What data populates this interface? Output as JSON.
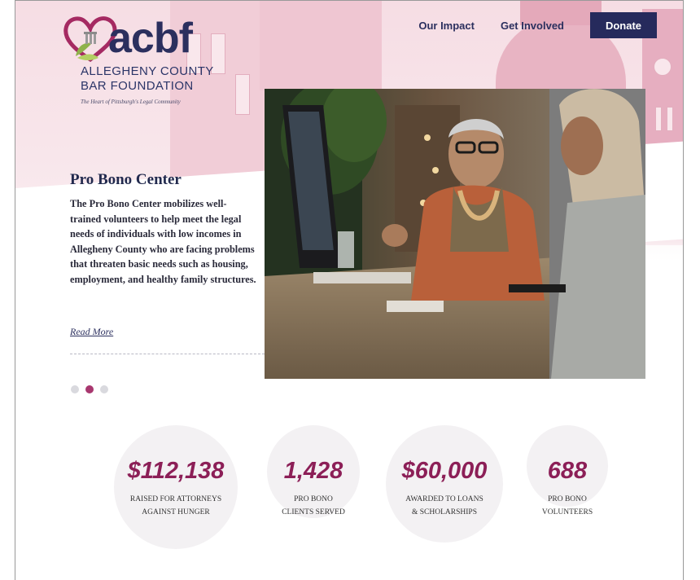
{
  "header": {
    "logo": {
      "wordmark": "acbf",
      "line1": "ALLEGHENY COUNTY",
      "line2": "BAR FOUNDATION",
      "tagline": "The Heart of Pittsburgh's Legal Community"
    },
    "nav": [
      "Our Impact",
      "Get Involved"
    ],
    "donate_label": "Donate"
  },
  "slide": {
    "title": "Pro Bono Center",
    "body": "The Pro Bono Center mobilizes well-trained volunteers to help meet the legal needs of individuals with low incomes in Allegheny County who are facing problems that threaten basic needs such as housing, employment, and healthy family structures.",
    "link_label": "Read More",
    "dots": {
      "count": 3,
      "active": 1
    }
  },
  "stats": [
    {
      "value": "$112,138",
      "label_line1": "RAISED FOR ATTORNEYS",
      "label_line2": "AGAINST HUNGER"
    },
    {
      "value": "1,428",
      "label_line1": "PRO BONO",
      "label_line2": "CLIENTS SERVED"
    },
    {
      "value": "$60,000",
      "label_line1": "AWARDED TO LOANS",
      "label_line2": "& SCHOLARSHIPS"
    },
    {
      "value": "688",
      "label_line1": "PRO BONO",
      "label_line2": "VOLUNTEERS"
    }
  ],
  "colors": {
    "brand_navy": "#2b2f5e",
    "brand_magenta": "#8c1f57",
    "dot_active": "#a8376f",
    "hero_tint": "#f6dde4"
  }
}
